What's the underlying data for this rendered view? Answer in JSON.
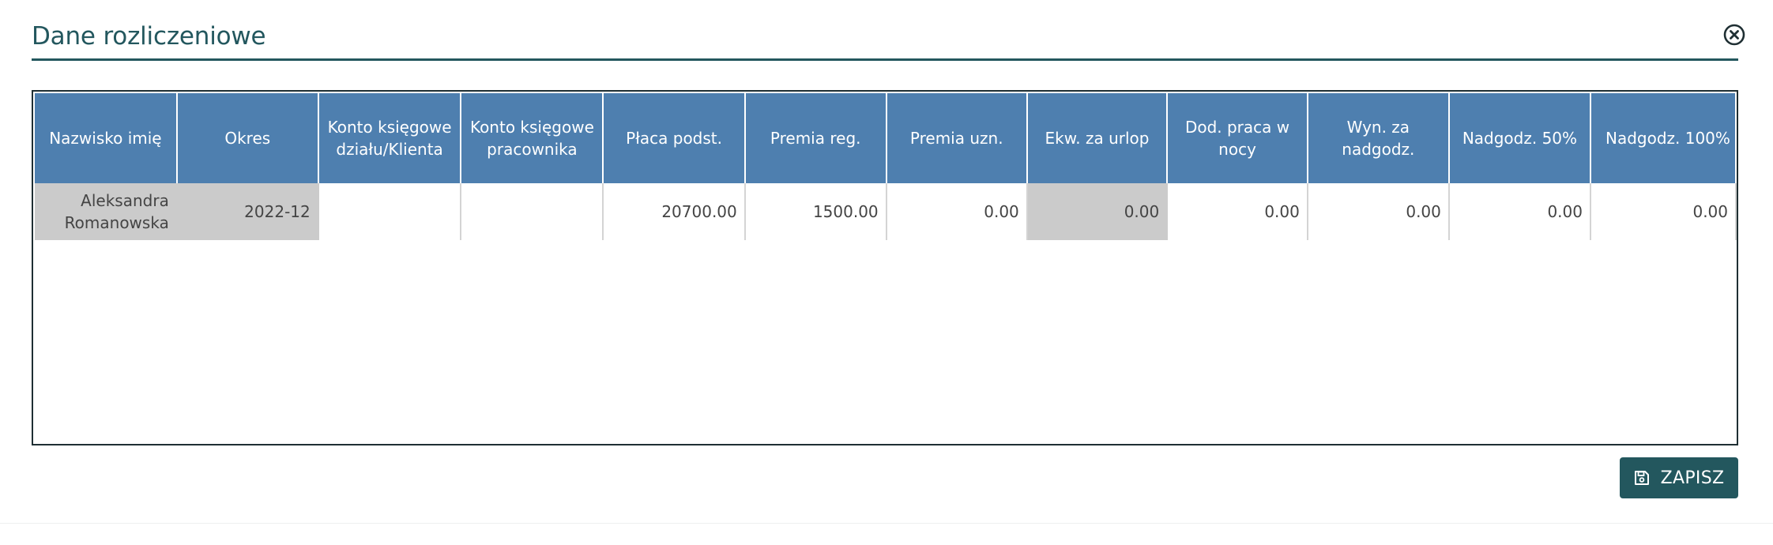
{
  "dialog": {
    "title": "Dane rozliczeniowe",
    "close_icon": "close-circle-icon"
  },
  "table": {
    "columns": [
      "Nazwisko imię",
      "Okres",
      "Konto księgowe działu/Klienta",
      "Konto księgowe pracownika",
      "Płaca podst.",
      "Premia reg.",
      "Premia uzn.",
      "Ekw. za urlop",
      "Dod. praca w nocy",
      "Wyn. za nadgodz.",
      "Nadgodz. 50%",
      "Nadgodz. 100%"
    ],
    "rows": [
      {
        "name": "Aleksandra Romanowska",
        "period": "2022-12",
        "dept_account": "",
        "employee_account": "",
        "base_pay": "20700.00",
        "regular_bonus": "1500.00",
        "discretionary_bonus": "0.00",
        "vacation_equivalent": "0.00",
        "night_work": "0.00",
        "overtime_pay": "0.00",
        "overtime_50": "0.00",
        "overtime_100": "0.00"
      }
    ]
  },
  "actions": {
    "save_label": "ZAPISZ",
    "save_icon": "floppy-disk-icon"
  },
  "colors": {
    "accent": "#23575e",
    "header_bg": "#4e7faf",
    "readonly_cell": "#cbcbcb"
  }
}
